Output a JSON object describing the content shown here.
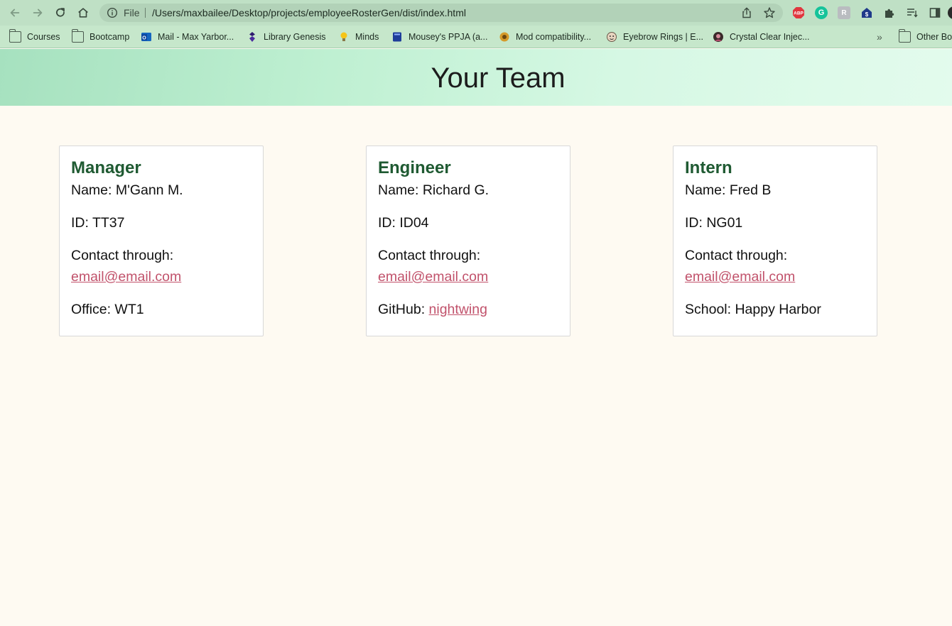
{
  "browser": {
    "scheme_label": "File",
    "url": "/Users/maxbailee/Desktop/projects/employeeRosterGen/dist/index.html",
    "extensions": [
      {
        "name": "adblock-icon",
        "label": "ABP",
        "color": "#e0373f"
      },
      {
        "name": "grammarly-icon",
        "label": "G",
        "color": "#15c39a"
      },
      {
        "name": "extension-r-icon",
        "label": "R",
        "color": "#b9bcc0"
      },
      {
        "name": "home-extension-icon",
        "label": "$",
        "color": "#1f3a8a"
      }
    ],
    "bookmarks": [
      {
        "label": "Courses",
        "icon": "folder-icon"
      },
      {
        "label": "Bootcamp",
        "icon": "folder-icon"
      },
      {
        "label": "Mail - Max Yarbor...",
        "icon": "outlook-icon"
      },
      {
        "label": "Library Genesis",
        "icon": "library-icon"
      },
      {
        "label": "Minds",
        "icon": "lightbulb-icon"
      },
      {
        "label": "Mousey's PPJA (a...",
        "icon": "book-icon"
      },
      {
        "label": "Mod compatibility...",
        "icon": "mod-icon"
      },
      {
        "label": "Eyebrow Rings | E...",
        "icon": "face-icon"
      },
      {
        "label": "Crystal Clear Injec...",
        "icon": "avatar-icon"
      }
    ],
    "overflow_label": "»",
    "other_bookmarks_label": "Other Bo"
  },
  "page": {
    "title": "Your Team"
  },
  "cards": [
    {
      "role": "Manager",
      "name_line": "Name: M'Gann M.",
      "id_line": "ID: TT37",
      "contact_label": "Contact through:",
      "email": "email@email.com",
      "extra_label": "Office: WT1",
      "extra_link": ""
    },
    {
      "role": "Engineer",
      "name_line": "Name: Richard G.",
      "id_line": "ID: ID04",
      "contact_label": "Contact through:",
      "email": "email@email.com",
      "extra_label": "GitHub: ",
      "extra_link": "nightwing"
    },
    {
      "role": "Intern",
      "name_line": "Name: Fred B",
      "id_line": "ID: NG01",
      "contact_label": "Contact through:",
      "email": "email@email.com",
      "extra_label": "School: Happy Harbor",
      "extra_link": ""
    }
  ]
}
